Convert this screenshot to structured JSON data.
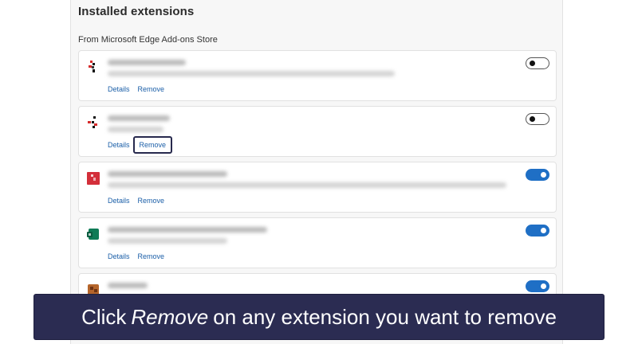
{
  "section": {
    "title": "Installed extensions",
    "subtitle": "From Microsoft Edge Add-ons Store"
  },
  "extensions": [
    {
      "details_label": "Details",
      "remove_label": "Remove",
      "enabled": false,
      "icon": "red-black-pixel-icon"
    },
    {
      "details_label": "Details",
      "remove_label": "Remove",
      "enabled": false,
      "icon": "red-black-pixel-icon",
      "remove_highlighted": true
    },
    {
      "details_label": "Details",
      "remove_label": "Remove",
      "enabled": true,
      "icon": "red-lock-icon"
    },
    {
      "details_label": "Details",
      "remove_label": "Remove",
      "enabled": true,
      "icon": "green-box-icon"
    },
    {
      "enabled": true,
      "icon": "brown-pixel-icon"
    }
  ],
  "caption": {
    "prefix": "Click",
    "emphasis": "Remove",
    "suffix": "on any extension you want to remove"
  },
  "colors": {
    "toggle_on": "#1f6fc5",
    "link": "#1b5fa8",
    "caption_bg": "#2b2c52"
  }
}
